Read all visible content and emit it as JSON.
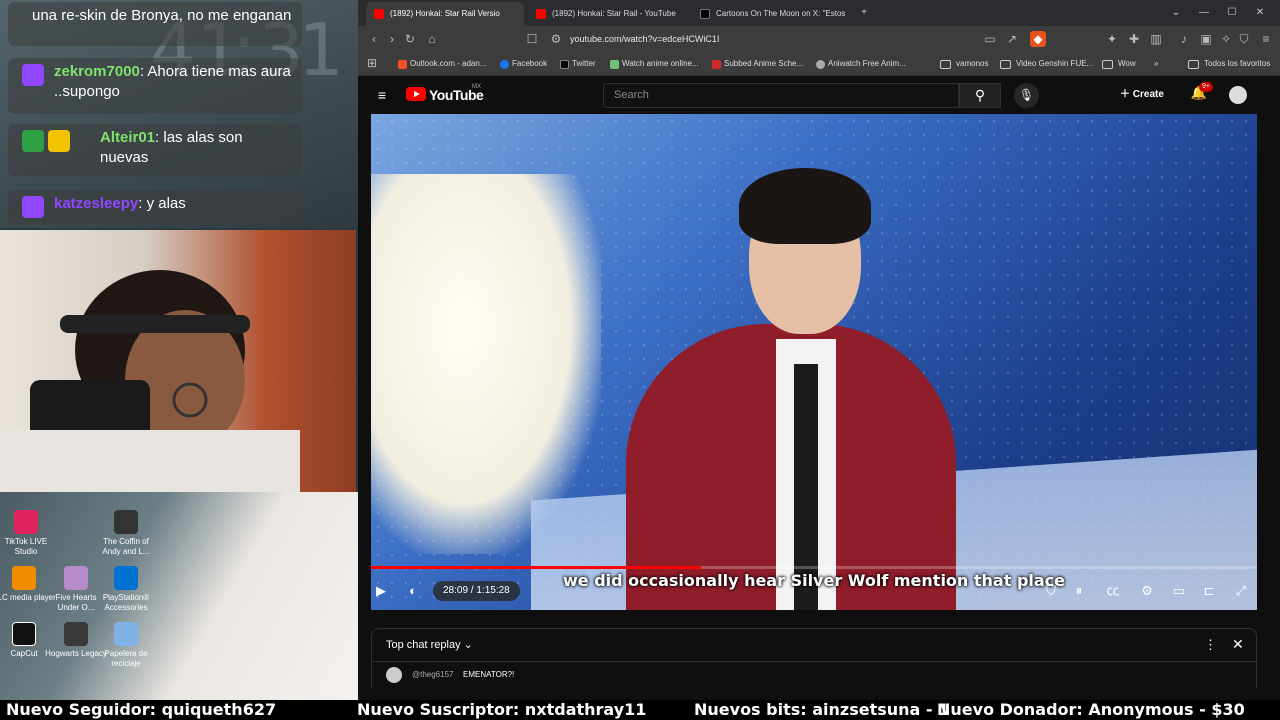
{
  "stream_chat": [
    {
      "user": "",
      "text": "una re-skin de Bronya, no me enganan"
    },
    {
      "user": "zekrom7000",
      "text": ": Ahora tiene mas aura ..supongo"
    },
    {
      "user": "Alteir01",
      "text": ": las alas son nuevas"
    },
    {
      "user": "katzesleepy",
      "text": ": y alas"
    }
  ],
  "clock": {
    "digits": [
      "4",
      "1",
      ":",
      "3",
      "1"
    ]
  },
  "desktop_icons": [
    {
      "label": "TikTok LIVE Studio"
    },
    {
      "label": "The Coffin of Andy and L..."
    },
    {
      "label": "VLC media player"
    },
    {
      "label": "Five Hearts Under O..."
    },
    {
      "label": "PlayStation® Accessories"
    },
    {
      "label": "CapCut"
    },
    {
      "label": "Hogwarts Legacy"
    },
    {
      "label": "Papelera de reciclaje"
    }
  ],
  "browser": {
    "tabs": [
      {
        "title": "(1892) Honkai: Star Rail Versio",
        "active": true
      },
      {
        "title": "(1892) Honkai: Star Rail - YouTube",
        "active": false
      },
      {
        "title": "Cartoons On The Moon on X: \"Estos",
        "active": false
      }
    ],
    "url": "youtube.com/watch?v=edceHCWiC1I",
    "bookmarks": [
      "Outlook.com - adan...",
      "Facebook",
      "Twitter",
      "Watch anime online...",
      "Subbed Anime Sche...",
      "Aniwatch Free Anim...",
      "vamonos",
      "Video Genshin FUE...",
      "Wow",
      "»",
      "Todos los favoritos"
    ]
  },
  "youtube": {
    "logo_text": "YouTube",
    "region": "MX",
    "search_placeholder": "Search",
    "create_label": "Create",
    "notif_badge": "9+",
    "subtitle": "we did occasionally hear Silver Wolf mention that place",
    "time": "28:09 / 1:15:28",
    "progress": 0.3727,
    "chat": {
      "title": "Top chat replay ⌄",
      "user": "@theg6157",
      "text": "EMENATOR?!"
    }
  },
  "ticker": [
    "Nuevo Seguidor: quiqueth627",
    "Nuevo Suscriptor: nxtdathray11",
    "Nuevos bits: ainzsetsuna - 1",
    "Nuevo Donador: Anonymous - $30"
  ],
  "colors": {
    "yt_red": "#ff0000",
    "twitch_purple": "#9146ff",
    "chat_green": "#7ee26b"
  }
}
